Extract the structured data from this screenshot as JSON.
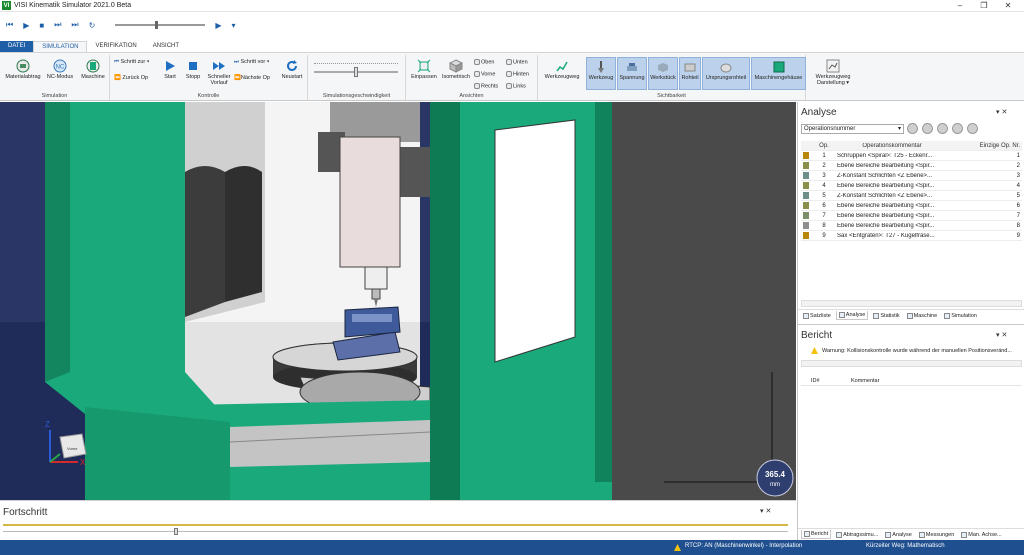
{
  "window": {
    "title": "VISI Kinematik Simulator 2021.0 Beta",
    "logo": "VI"
  },
  "tabs": [
    {
      "label": "DATEI"
    },
    {
      "label": "SIMULATION"
    },
    {
      "label": "VERIFIKATION"
    },
    {
      "label": "ANSICHT"
    }
  ],
  "ribbon": {
    "simulation": {
      "label": "Simulation",
      "materialabtrag": "Materialabtrag",
      "nc_modus": "NC-Modus",
      "maschine": "Maschine"
    },
    "kontrolle": {
      "label": "Kontrolle",
      "schritt_zur": "Schritt zur",
      "zurueck_op": "Zurück Op",
      "start": "Start",
      "stopp": "Stopp",
      "schneller": "Schneller",
      "vorlauf": "Vorlauf",
      "schritt_vor": "Schritt vor",
      "naechste_op": "Nächste Op",
      "neustart": "Neustart"
    },
    "geschwindigkeit": {
      "label": "Simulationsgeschwindigkeit"
    },
    "ansichten": {
      "label": "Ansichten",
      "einpassen": "Einpassen",
      "isometrisch": "Isometrisch",
      "oben": "Oben",
      "unten": "Unten",
      "vorne": "Vorne",
      "hinten": "Hinten",
      "rechts": "Rechts",
      "links": "Links"
    },
    "sichtbarkeit": {
      "label": "Sichtbarkeit",
      "werkzeugweg": "Werkzeugweg",
      "werkzeug": "Werkzeug",
      "spannung": "Spannung",
      "werkstueck": "Werkstück",
      "rohteil": "Rohteil",
      "ursprungsrohteil": "Ursprungsrohteil",
      "maschinengehaeuse": "Maschinengehäuse",
      "darstellung_1": "Werkzeugweg",
      "darstellung_2": "Darstellung"
    }
  },
  "viewport": {
    "measure_value": "365.4",
    "measure_unit": "mm",
    "axis_z": "Z",
    "axis_x": "X",
    "cube_face": "Vorne"
  },
  "fortschritt": {
    "title": "Fortschritt"
  },
  "analyse": {
    "title": "Analyse",
    "dropdown": "Operationsnummer",
    "columns": {
      "op": "Op.",
      "kommentar": "Operationskommentar",
      "nr": "Einzige Op. Nr."
    },
    "rows": [
      {
        "op": "1",
        "kommentar": "Schruppen <Spiral>: T25 - Eckenr...",
        "nr": "1",
        "color": "#b8860b"
      },
      {
        "op": "2",
        "kommentar": "Ebene Bereiche Bearbeitung <Spir...",
        "nr": "2",
        "color": "#8a8f4a"
      },
      {
        "op": "3",
        "kommentar": "Z-Konstant Schlichten <Z Ebene>...",
        "nr": "3",
        "color": "#6f8f8a"
      },
      {
        "op": "4",
        "kommentar": "Ebene Bereiche Bearbeitung <Spir...",
        "nr": "4",
        "color": "#8a8f4a"
      },
      {
        "op": "5",
        "kommentar": "Z-Konstant Schlichten <Z Ebene>...",
        "nr": "5",
        "color": "#6f8f8a"
      },
      {
        "op": "6",
        "kommentar": "Ebene Bereiche Bearbeitung <Spir...",
        "nr": "6",
        "color": "#8a8f4a"
      },
      {
        "op": "7",
        "kommentar": "Ebene Bereiche Bearbeitung <Spir...",
        "nr": "7",
        "color": "#7b8f6a"
      },
      {
        "op": "8",
        "kommentar": "Ebene Bereiche Bearbeitung <Spir...",
        "nr": "8",
        "color": "#8f8f8f"
      },
      {
        "op": "9",
        "kommentar": "Sax <Entgraten>: T27 - Kugelfräse...",
        "nr": "9",
        "color": "#b8860b"
      }
    ],
    "tabs": {
      "satzliste": "Satzliste",
      "analyse": "Analyse",
      "statistik": "Statistik",
      "maschine": "Maschine",
      "simulation": "Simulation"
    }
  },
  "bericht": {
    "title": "Bericht",
    "warning": "Warnung: Kollisionskontrolle wurde während der manuellen Positionsveränd...",
    "col_id": "ID#",
    "col_kommentar": "Kommentar",
    "tabs": {
      "bericht": "Bericht",
      "abtrag": "Abtragssimu...",
      "analyse": "Analyse",
      "messungen": "Messungen",
      "achsen": "Man. Achse..."
    }
  },
  "statusbar": {
    "rtcp": "RTCP: AN (Maschinenwinkel) - Interpolation",
    "weg": "Kürzeiter Weg: Mathematisch"
  },
  "colors": {
    "accent": "#1f5fa8",
    "machine_green": "#1aa97a",
    "status_bar": "#1f4f8f"
  }
}
